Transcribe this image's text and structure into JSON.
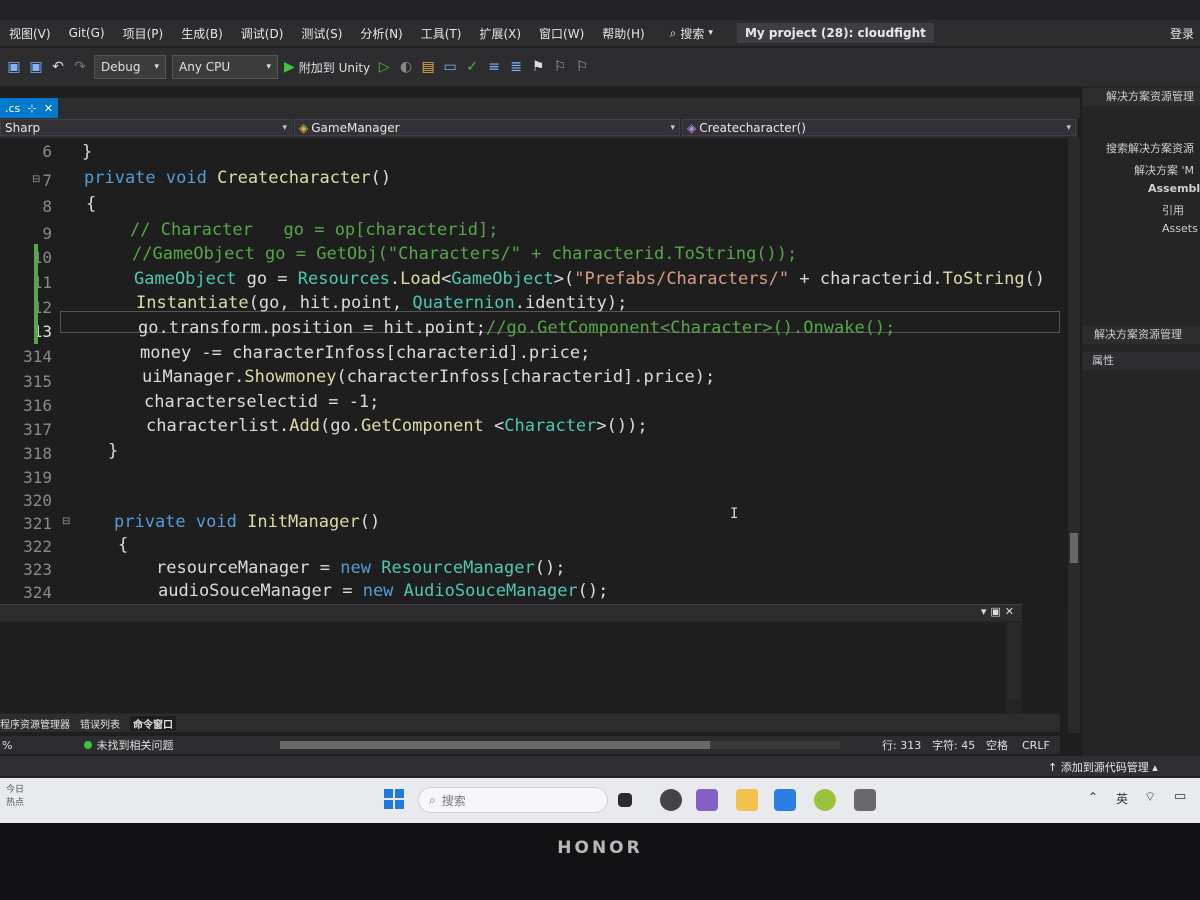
{
  "menubar": {
    "items": [
      "视图(V)",
      "Git(G)",
      "项目(P)",
      "生成(B)",
      "调试(D)",
      "测试(S)",
      "分析(N)",
      "工具(T)",
      "扩展(X)",
      "窗口(W)",
      "帮助(H)"
    ],
    "search_label": "搜索",
    "window_title": "My project (28): cloudfight",
    "right_label": "登录"
  },
  "toolbar": {
    "config": "Debug",
    "platform": "Any CPU",
    "run_label": "附加到 Unity"
  },
  "editor": {
    "tab_label": ".cs",
    "nav_project": "Sharp",
    "nav_class": "GameManager",
    "nav_member": "Createcharacter()",
    "line_numbers": [
      "6",
      "7",
      "8",
      "9",
      "10",
      "11",
      "12",
      "13",
      "314",
      "315",
      "316",
      "317",
      "318",
      "319",
      "320",
      "321",
      "322",
      "323",
      "324"
    ]
  },
  "code": {
    "l1": "}",
    "l2_kw1": "private",
    "l2_kw2": "void",
    "l2_name": "Createcharacter",
    "l2_rest": "()",
    "l3": "{",
    "l4": "// Character   go = op[characterid];",
    "l5": "//GameObject go = GetObj(\"Characters/\" + characterid.ToString());",
    "l6_type": "GameObject",
    "l6_a": " go = ",
    "l6_res": "Resources",
    "l6_b": ".",
    "l6_load": "Load",
    "l6_c": "<",
    "l6_type2": "GameObject",
    "l6_d": ">(",
    "l6_str": "\"Prefabs/Characters/\"",
    "l6_e": " + characterid.",
    "l6_tostr": "ToString",
    "l6_f": "()",
    "l7_inst": "Instantiate",
    "l7_a": "(go, hit.point, ",
    "l7_quat": "Quaternion",
    "l7_b": ".identity);",
    "l8_code": "go.transform.position = hit.point;",
    "l8_comment": "//go.GetComponent<Character>().Onwake();",
    "l9": "money -= characterInfoss[characterid].price;",
    "l10_a": "uiManager.",
    "l10_m": "Showmoney",
    "l10_b": "(characterInfoss[characterid].price);",
    "l11": "characterselectid = -1;",
    "l12_a": "characterlist.",
    "l12_add": "Add",
    "l12_b": "(go.",
    "l12_gc": "GetComponent",
    "l12_c": " <",
    "l12_ty": "Character",
    "l12_d": ">());",
    "l13": "}",
    "l16_kw1": "private",
    "l16_kw2": "void",
    "l16_name": "InitManager",
    "l16_rest": "()",
    "l17": "{",
    "l18_a": "resourceManager = ",
    "l18_new": "new",
    "l18_ty": "ResourceManager",
    "l18_b": "();",
    "l19_a": "audioSouceManager = ",
    "l19_new": "new",
    "l19_ty": "AudioSouceManager",
    "l19_b": "();"
  },
  "bottom_tabs": [
    "程序资源管理器",
    "错误列表",
    "命令窗口"
  ],
  "editor_status": {
    "zoom": "%",
    "issues": "未找到相关问题",
    "line": "行: 313",
    "col": "字符: 45",
    "spaces": "空格",
    "eol": "CRLF"
  },
  "vs_status": {
    "source_control": "添加到源代码管理"
  },
  "right_panel": {
    "header1": "解决方案资源管理",
    "search": "搜索解决方案资源",
    "solution": "解决方案 'M",
    "assembly": "Assembl",
    "refs": "引用",
    "assets": "Assets",
    "header2": "解决方案资源管理",
    "header3": "属性"
  },
  "taskbar": {
    "weather_line1": "今日",
    "weather_line2": "热点",
    "search_placeholder": "搜索",
    "ime": "英"
  },
  "device": {
    "brand": "HONOR"
  }
}
